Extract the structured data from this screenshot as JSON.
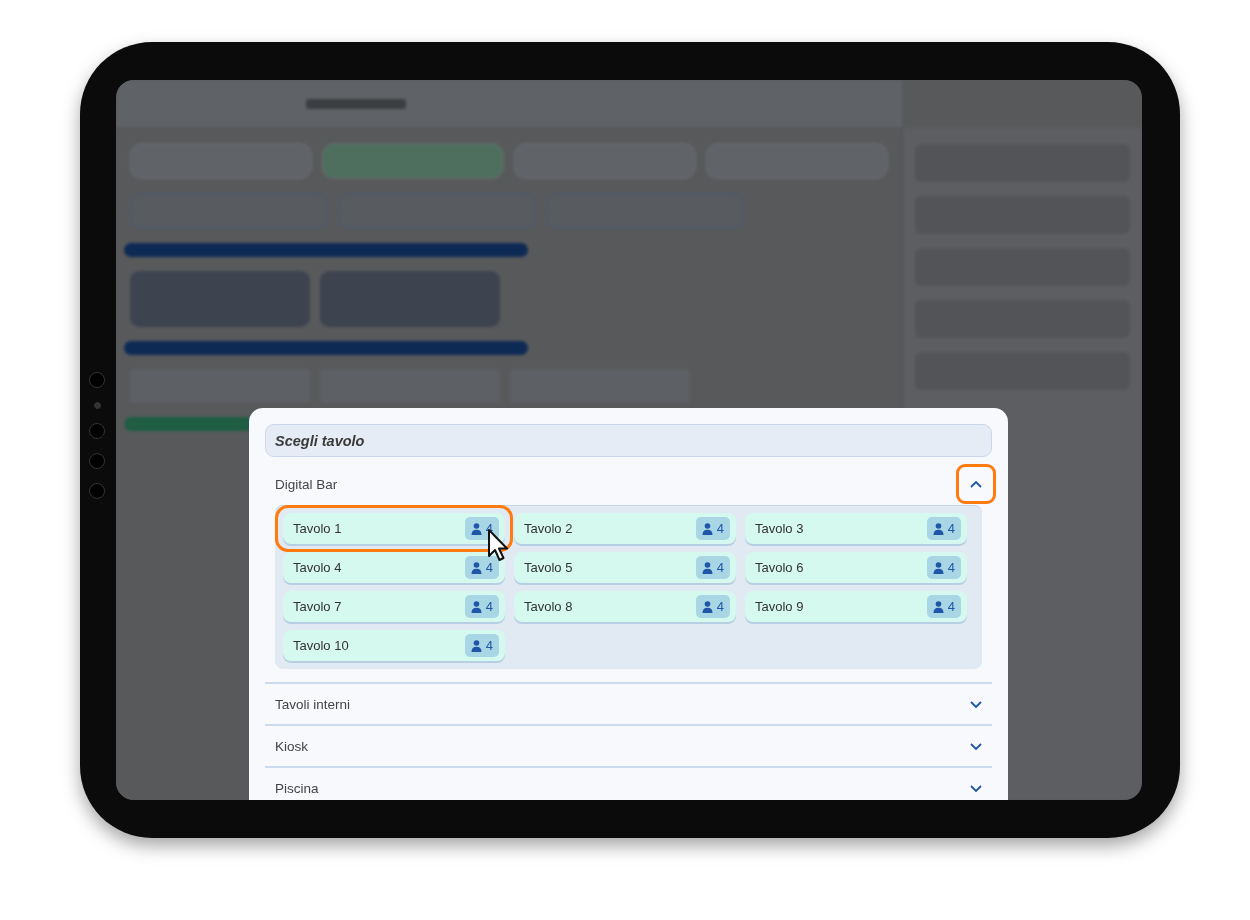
{
  "dialog": {
    "title": "Scegli tavolo"
  },
  "sections": [
    {
      "label": "Digital Bar",
      "expanded": true,
      "highlighted": true,
      "tables": [
        {
          "label": "Tavolo 1",
          "seats": "4",
          "highlighted": true
        },
        {
          "label": "Tavolo 2",
          "seats": "4",
          "highlighted": false
        },
        {
          "label": "Tavolo 3",
          "seats": "4",
          "highlighted": false
        },
        {
          "label": "Tavolo 4",
          "seats": "4",
          "highlighted": false
        },
        {
          "label": "Tavolo 5",
          "seats": "4",
          "highlighted": false
        },
        {
          "label": "Tavolo 6",
          "seats": "4",
          "highlighted": false
        },
        {
          "label": "Tavolo 7",
          "seats": "4",
          "highlighted": false
        },
        {
          "label": "Tavolo 8",
          "seats": "4",
          "highlighted": false
        },
        {
          "label": "Tavolo 9",
          "seats": "4",
          "highlighted": false
        },
        {
          "label": "Tavolo 10",
          "seats": "4",
          "highlighted": false
        }
      ]
    },
    {
      "label": "Tavoli interni",
      "expanded": false,
      "highlighted": false
    },
    {
      "label": "Kiosk",
      "expanded": false,
      "highlighted": false
    },
    {
      "label": "Piscina",
      "expanded": false,
      "highlighted": false
    }
  ]
}
